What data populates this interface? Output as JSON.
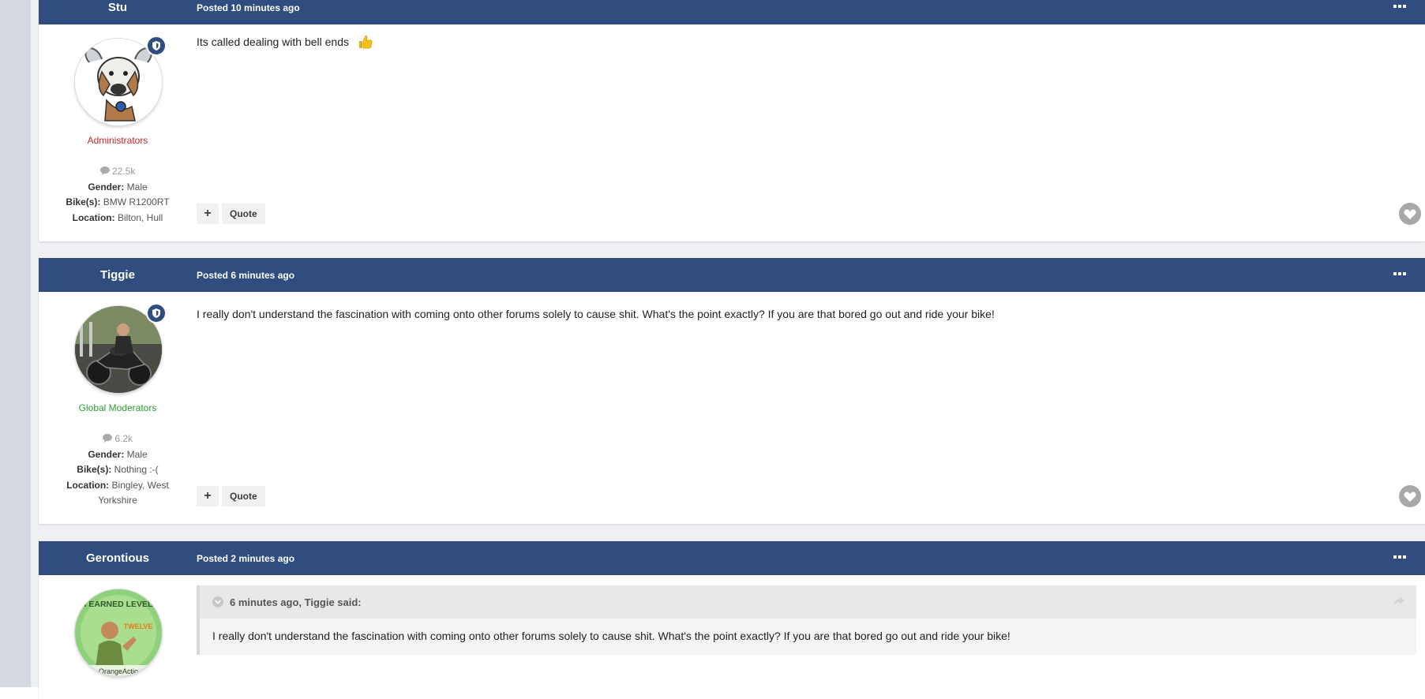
{
  "posts": [
    {
      "author": "Stu",
      "date": "Posted 10 minutes ago",
      "group": "Administrators",
      "group_color": "#c4262e",
      "post_count": "22.5k",
      "gender_label": "Gender:",
      "gender": "Male",
      "bike_label": "Bike(s):",
      "bike": "BMW R1200RT",
      "location_label": "Location:",
      "location": "Bilton, Hull",
      "content": "Its called dealing with bell ends",
      "emoji": "thumbs-up-icon",
      "quote_button": "Quote"
    },
    {
      "author": "Tiggie",
      "date": "Posted 6 minutes ago",
      "group": "Global Moderators",
      "group_color": "#2e9e35",
      "post_count": "6.2k",
      "gender_label": "Gender:",
      "gender": "Male",
      "bike_label": "Bike(s):",
      "bike": "Nothing :-(",
      "location_label": "Location:",
      "location": "Bingley, West Yorkshire",
      "content": "I really don't understand the fascination with coming onto other forums solely to cause shit. What's the point exactly? If you are that bored go out and ride your bike!",
      "quote_button": "Quote"
    },
    {
      "author": "Gerontious",
      "date": "Posted 2 minutes ago",
      "avatar_text_top": "I EARNED LEVEL",
      "avatar_text_mid": "TWELVE",
      "avatar_text_bottom": "OrangeActio",
      "quote_citation": "6 minutes ago, Tiggie said:",
      "quote_content": "I really don't understand the fascination with coming onto other forums solely to cause shit. What's the point exactly? If you are that bored go out and ride your bike!"
    }
  ],
  "colors": {
    "header_bar": "#2f4d7e",
    "page_background": "#eef0f4",
    "side_strip": "#d5d9e2"
  }
}
